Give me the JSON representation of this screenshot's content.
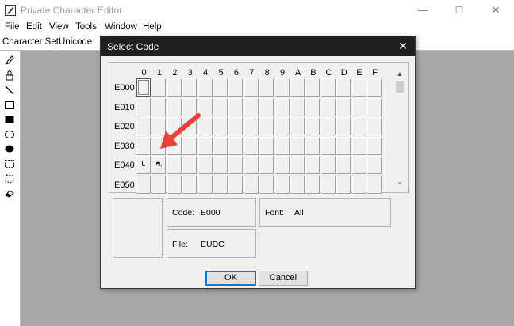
{
  "app": {
    "title": "Private Character Editor",
    "minimize": "—",
    "maximize": "☐",
    "close": "✕"
  },
  "menu": [
    "File",
    "Edit",
    "View",
    "Tools",
    "Window",
    "Help"
  ],
  "charset": {
    "label": "Character Set:",
    "value": "Unicode"
  },
  "tools": [
    "pencil-icon",
    "brush-icon",
    "line-icon",
    "hollow-rectangle-icon",
    "filled-rectangle-icon",
    "hollow-ellipse-icon",
    "filled-ellipse-icon",
    "rectangular-selection-icon",
    "freeform-selection-icon",
    "eraser-icon"
  ],
  "dialog": {
    "title": "Select Code",
    "close": "✕",
    "columns": [
      "0",
      "1",
      "2",
      "3",
      "4",
      "5",
      "6",
      "7",
      "8",
      "9",
      "A",
      "B",
      "C",
      "D",
      "E",
      "F"
    ],
    "rows": [
      "E000",
      "E010",
      "E020",
      "E030",
      "E040",
      "E050"
    ],
    "selected_cell": {
      "row": 0,
      "col": 0
    },
    "glyph_cells": [
      {
        "row": 4,
        "col": 0,
        "glyph": "ᒐ"
      },
      {
        "row": 4,
        "col": 1,
        "glyph": "⛐"
      }
    ],
    "scroll_up": "▲",
    "scroll_down": "⌄",
    "code_label": "Code:",
    "code_value": "E000",
    "font_label": "Font:",
    "font_value": "All",
    "file_label": "File:",
    "file_value": "EUDC",
    "ok_label": "OK",
    "cancel_label": "Cancel"
  },
  "colors": {
    "arrow": "#e8413a",
    "dialog_title_bg": "#1f1f1f",
    "workspace": "#a8a8a8",
    "default_button_border": "#0078d7"
  }
}
